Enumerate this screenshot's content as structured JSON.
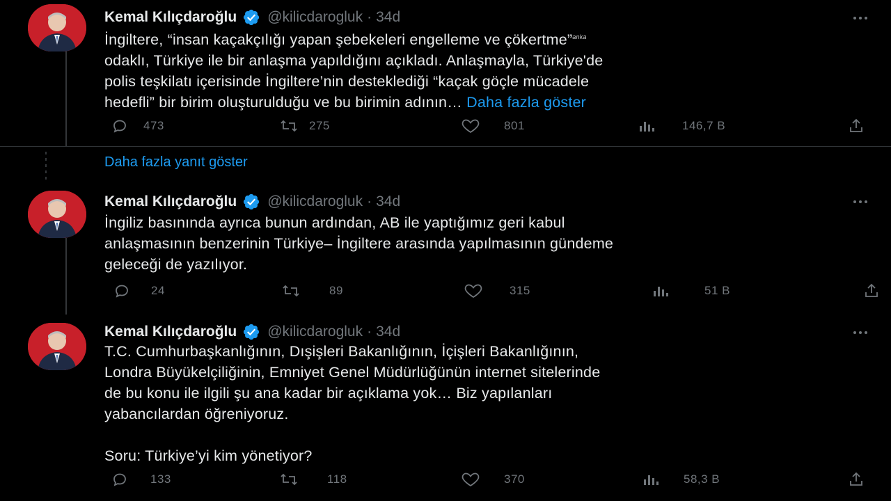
{
  "replies_link": "Daha fazla yanıt göster",
  "colors": {
    "background": "#000000",
    "text": "#e7e9ea",
    "muted": "#71767b",
    "link": "#1d9bf0",
    "verified": "#1d9bf0"
  },
  "tweets": [
    {
      "name": "Kemal Kılıçdaroğlu",
      "handle": "@kilicdarogluk",
      "separator": "·",
      "time": "34d",
      "lines": [
        "İngiltere, “insan kaçakçılığı yapan şebekeleri engelleme ve çökertme”",
        "odaklı, Türkiye ile bir anlaşma yapıldığını açıkladı. Anlaşmayla, Türkiye'de",
        "polis teşkilatı içerisinde İngiltere’nin desteklediği “kaçak göçle mücadele",
        "hedefli” bir birim oluşturulduğu ve bu birimin adının…"
      ],
      "show_more": "Daha fazla göster",
      "watermark": "anka",
      "stats": {
        "replies": "473",
        "retweets": "275",
        "likes": "801",
        "views": "146,7 B"
      }
    },
    {
      "name": "Kemal Kılıçdaroğlu",
      "handle": "@kilicdarogluk",
      "separator": "·",
      "time": "34d",
      "lines": [
        "İngiliz basınında ayrıca bunun ardından, AB ile yaptığımız geri kabul",
        "anlaşmasının benzerinin Türkiye– İngiltere arasında yapılmasının gündeme",
        "geleceği de yazılıyor."
      ],
      "stats": {
        "replies": "24",
        "retweets": "89",
        "likes": "315",
        "views": "51 B"
      }
    },
    {
      "name": "Kemal Kılıçdaroğlu",
      "handle": "@kilicdarogluk",
      "separator": "·",
      "time": "34d",
      "lines": [
        "T.C. Cumhurbaşkanlığının, Dışişleri Bakanlığının, İçişleri Bakanlığının,",
        "Londra Büyükelçiliğinin, Emniyet Genel Müdürlüğünün internet sitelerinde",
        "de bu konu ile ilgili şu ana kadar bir açıklama yok… Biz yapılanları",
        "yabancılardan öğreniyoruz.",
        "",
        "Soru: Türkiye’yi kim yönetiyor?"
      ],
      "stats": {
        "replies": "133",
        "retweets": "118",
        "likes": "370",
        "views": "58,3 B"
      }
    }
  ]
}
